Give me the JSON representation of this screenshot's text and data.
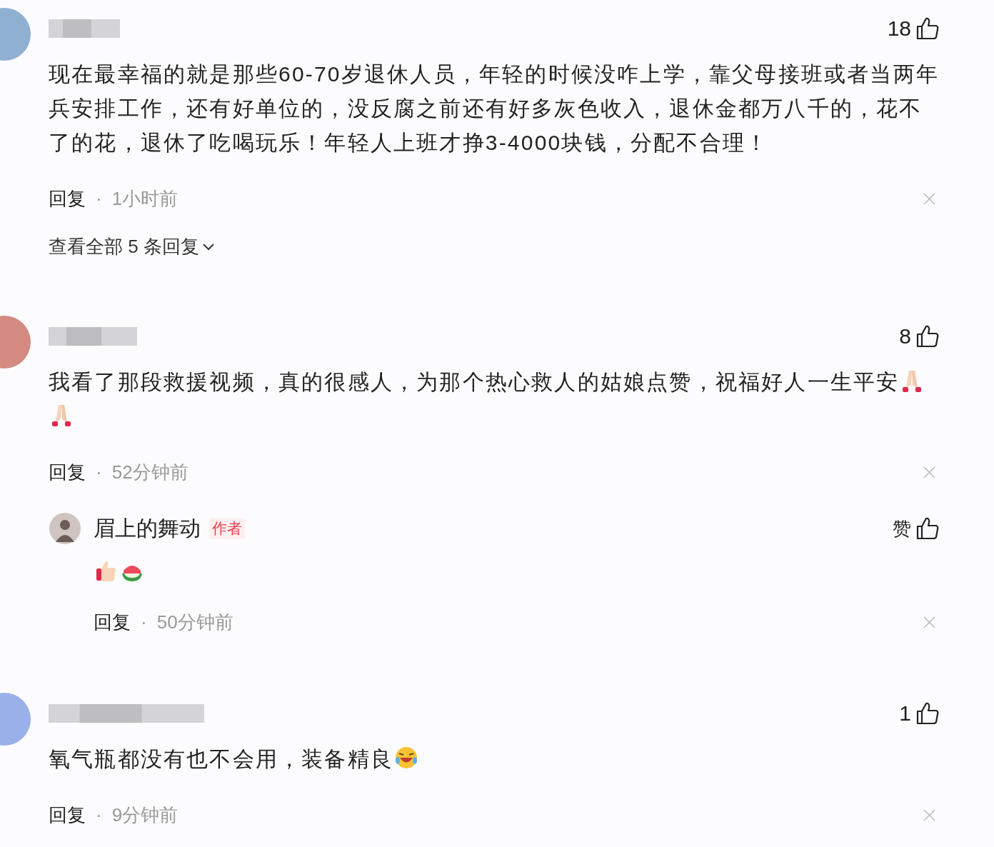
{
  "comments": [
    {
      "likes": "18",
      "text": "现在最幸福的就是那些60-70岁退休人员，年轻的时候没咋上学，靠父母接班或者当两年兵安排工作，还有好单位的，没反腐之前还有好多灰色收入，退休金都万八千的，花不了的花，退休了吃喝玩乐！年轻人上班才挣3-4000块钱，分配不合理！",
      "reply_label": "回复",
      "separator": "·",
      "time": "1小时前",
      "more_replies": "查看全部 5 条回复"
    },
    {
      "likes": "8",
      "text": "我看了那段救援视频，真的很感人，为那个热心救人的姑娘点赞，祝福好人一生平安",
      "emojis": [
        {
          "kind": "pray"
        },
        {
          "kind": "pray"
        }
      ],
      "reply_label": "回复",
      "separator": "·",
      "time": "52分钟前",
      "replies": [
        {
          "author": "眉上的舞动",
          "badge": "作者",
          "likes": "赞",
          "emojis": [
            {
              "kind": "thumbs"
            },
            {
              "kind": "watermelon"
            }
          ],
          "reply_label": "回复",
          "separator": "·",
          "time": "50分钟前"
        }
      ]
    },
    {
      "likes": "1",
      "text": "氧气瓶都没有也不会用，装备精良",
      "emojis": [
        {
          "kind": "laugh"
        }
      ],
      "reply_label": "回复",
      "separator": "·",
      "time": "9分钟前"
    }
  ]
}
